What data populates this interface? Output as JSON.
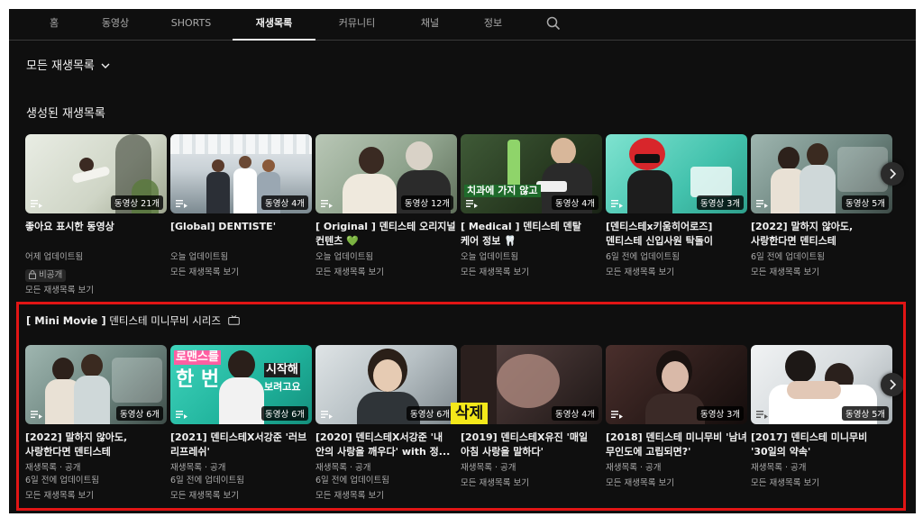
{
  "tabs": [
    {
      "label": "홈",
      "active": false
    },
    {
      "label": "동영상",
      "active": false
    },
    {
      "label": "SHORTS",
      "active": false
    },
    {
      "label": "재생목록",
      "active": true
    },
    {
      "label": "커뮤니티",
      "active": false
    },
    {
      "label": "채널",
      "active": false
    },
    {
      "label": "정보",
      "active": false
    }
  ],
  "filter_label": "모든 재생목록",
  "sections": [
    {
      "title": "생성된 재생목록",
      "highlighted": false,
      "cards": [
        {
          "title": "좋아요 표시한 동영상",
          "count": "동영상 21개",
          "updated": "어제 업데이트됨",
          "private": "비공개",
          "view_all": "모든 재생목록 보기"
        },
        {
          "title": "[Global] DENTISTE'",
          "count": "동영상 4개",
          "updated": "오늘 업데이트됨",
          "view_all": "모든 재생목록 보기"
        },
        {
          "title": "[ Original ] 덴티스테 오리지널 컨텐츠 💚",
          "count": "동영상 12개",
          "updated": "오늘 업데이트됨",
          "view_all": "모든 재생목록 보기",
          "thumb_text": ""
        },
        {
          "title": "[ Medical ] 덴티스테 덴탈 케어 정보 🦷",
          "count": "동영상 4개",
          "updated": "오늘 업데이트됨",
          "view_all": "모든 재생목록 보기",
          "thumb_text": "치과에 가지 않고"
        },
        {
          "title": "[덴티스테x키움히어로즈] 덴티스테 신입사원 탁돌이",
          "count": "동영상 3개",
          "updated": "6일 전에 업데이트됨",
          "view_all": "모든 재생목록 보기"
        },
        {
          "title": "[2022] 말하지 않아도, 사랑한다면 덴티스테",
          "count": "동영상 5개",
          "updated": "6일 전에 업데이트됨",
          "view_all": "모든 재생목록 보기"
        }
      ]
    },
    {
      "title_prefix": "[ Mini Movie ]",
      "title": " 덴티스테 미니무비 시리즈",
      "highlighted": true,
      "cards": [
        {
          "title": "[2022] 말하지 않아도, 사랑한다면 덴티스테",
          "count": "동영상 6개",
          "visibility": "재생목록 · 공개",
          "updated": "6일 전에 업데이트됨",
          "view_all": "모든 재생목록 보기"
        },
        {
          "title": "[2021] 덴티스테X서강준 '러브 리프레쉬'",
          "count": "동영상 6개",
          "visibility": "재생목록 · 공개",
          "updated": "6일 전에 업데이트됨",
          "view_all": "모든 재생목록 보기",
          "thumb_text": [
            "로맨스를",
            "한 번",
            "시작해",
            "보려고요"
          ]
        },
        {
          "title": "[2020] 덴티스테X서강준 '내 안의 사랑을 깨우다' with 정...",
          "count": "동영상 6개",
          "visibility": "재생목록 · 공개",
          "updated": "6일 전에 업데이트됨",
          "view_all": "모든 재생목록 보기"
        },
        {
          "title": "[2019] 덴티스테X유진 '매일 아침 사랑을 말하다'",
          "count": "동영상 4개",
          "visibility": "재생목록 · 공개",
          "view_all": "모든 재생목록 보기"
        },
        {
          "title": "[2018] 덴티스테 미니무비 '남녀 무인도에 고립되면?'",
          "count": "동영상 3개",
          "visibility": "재생목록 · 공개",
          "view_all": "모든 재생목록 보기"
        },
        {
          "title": "[2017] 덴티스테 미니무비 '30일의 약속'",
          "count": "동영상 5개",
          "visibility": "재생목록 · 공개",
          "view_all": "모든 재생목록 보기"
        }
      ]
    }
  ],
  "overlay_label": "삭제",
  "colors": {
    "background": "#0f0f0f",
    "highlight_border": "#e11515",
    "overlay_bg": "#f4e81a",
    "tab_active": "#f1f1f1"
  },
  "icons": [
    "search-icon",
    "chevron-down-icon",
    "playlist-icon",
    "lock-icon",
    "chevron-right-icon",
    "tv-icon"
  ]
}
